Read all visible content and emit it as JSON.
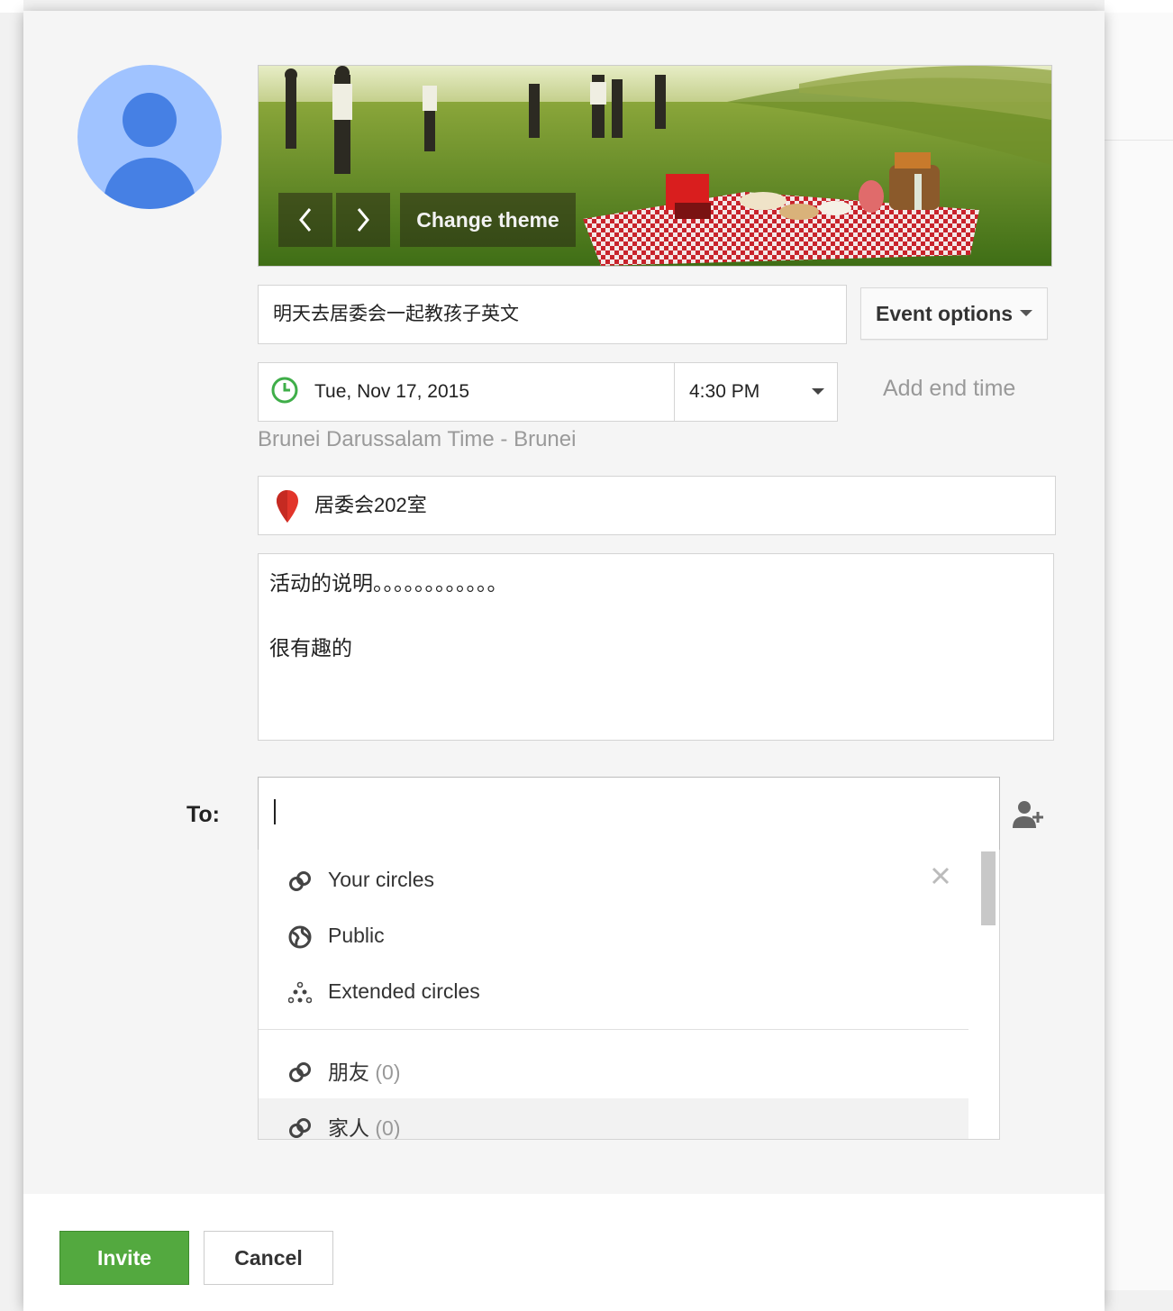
{
  "header": {
    "theme_change_label": "Change theme",
    "theme_prev_icon": "chevron-left-icon",
    "theme_next_icon": "chevron-right-icon"
  },
  "event": {
    "title_value": "明天去居委会一起教孩子英文",
    "options_label": "Event options",
    "date_value": "Tue, Nov 17, 2015",
    "time_value": "4:30 PM",
    "add_end_time_label": "Add end time",
    "timezone": "Brunei Darussalam Time - Brunei",
    "location_value": "居委会202室",
    "description_line1": "活动的说明。。。。。。。。。。。。",
    "description_line2": "很有趣的"
  },
  "invite": {
    "to_label": "To:",
    "to_value": "",
    "suggestions": [
      {
        "label": "Your circles",
        "icon": "circles-icon"
      },
      {
        "label": "Public",
        "icon": "globe-icon"
      },
      {
        "label": "Extended circles",
        "icon": "extended-circles-icon"
      }
    ],
    "circles": [
      {
        "label": "朋友",
        "count": "(0)",
        "icon": "circles-icon"
      },
      {
        "label": "家人",
        "count": "(0)",
        "icon": "circles-icon"
      }
    ]
  },
  "footer": {
    "invite_label": "Invite",
    "cancel_label": "Cancel"
  },
  "colors": {
    "invite_button": "#53a93f",
    "avatar_bg": "#a0c3ff",
    "avatar_fg": "#4680e4",
    "clock_icon": "#3fae49",
    "pin_icon": "#e2352b"
  }
}
